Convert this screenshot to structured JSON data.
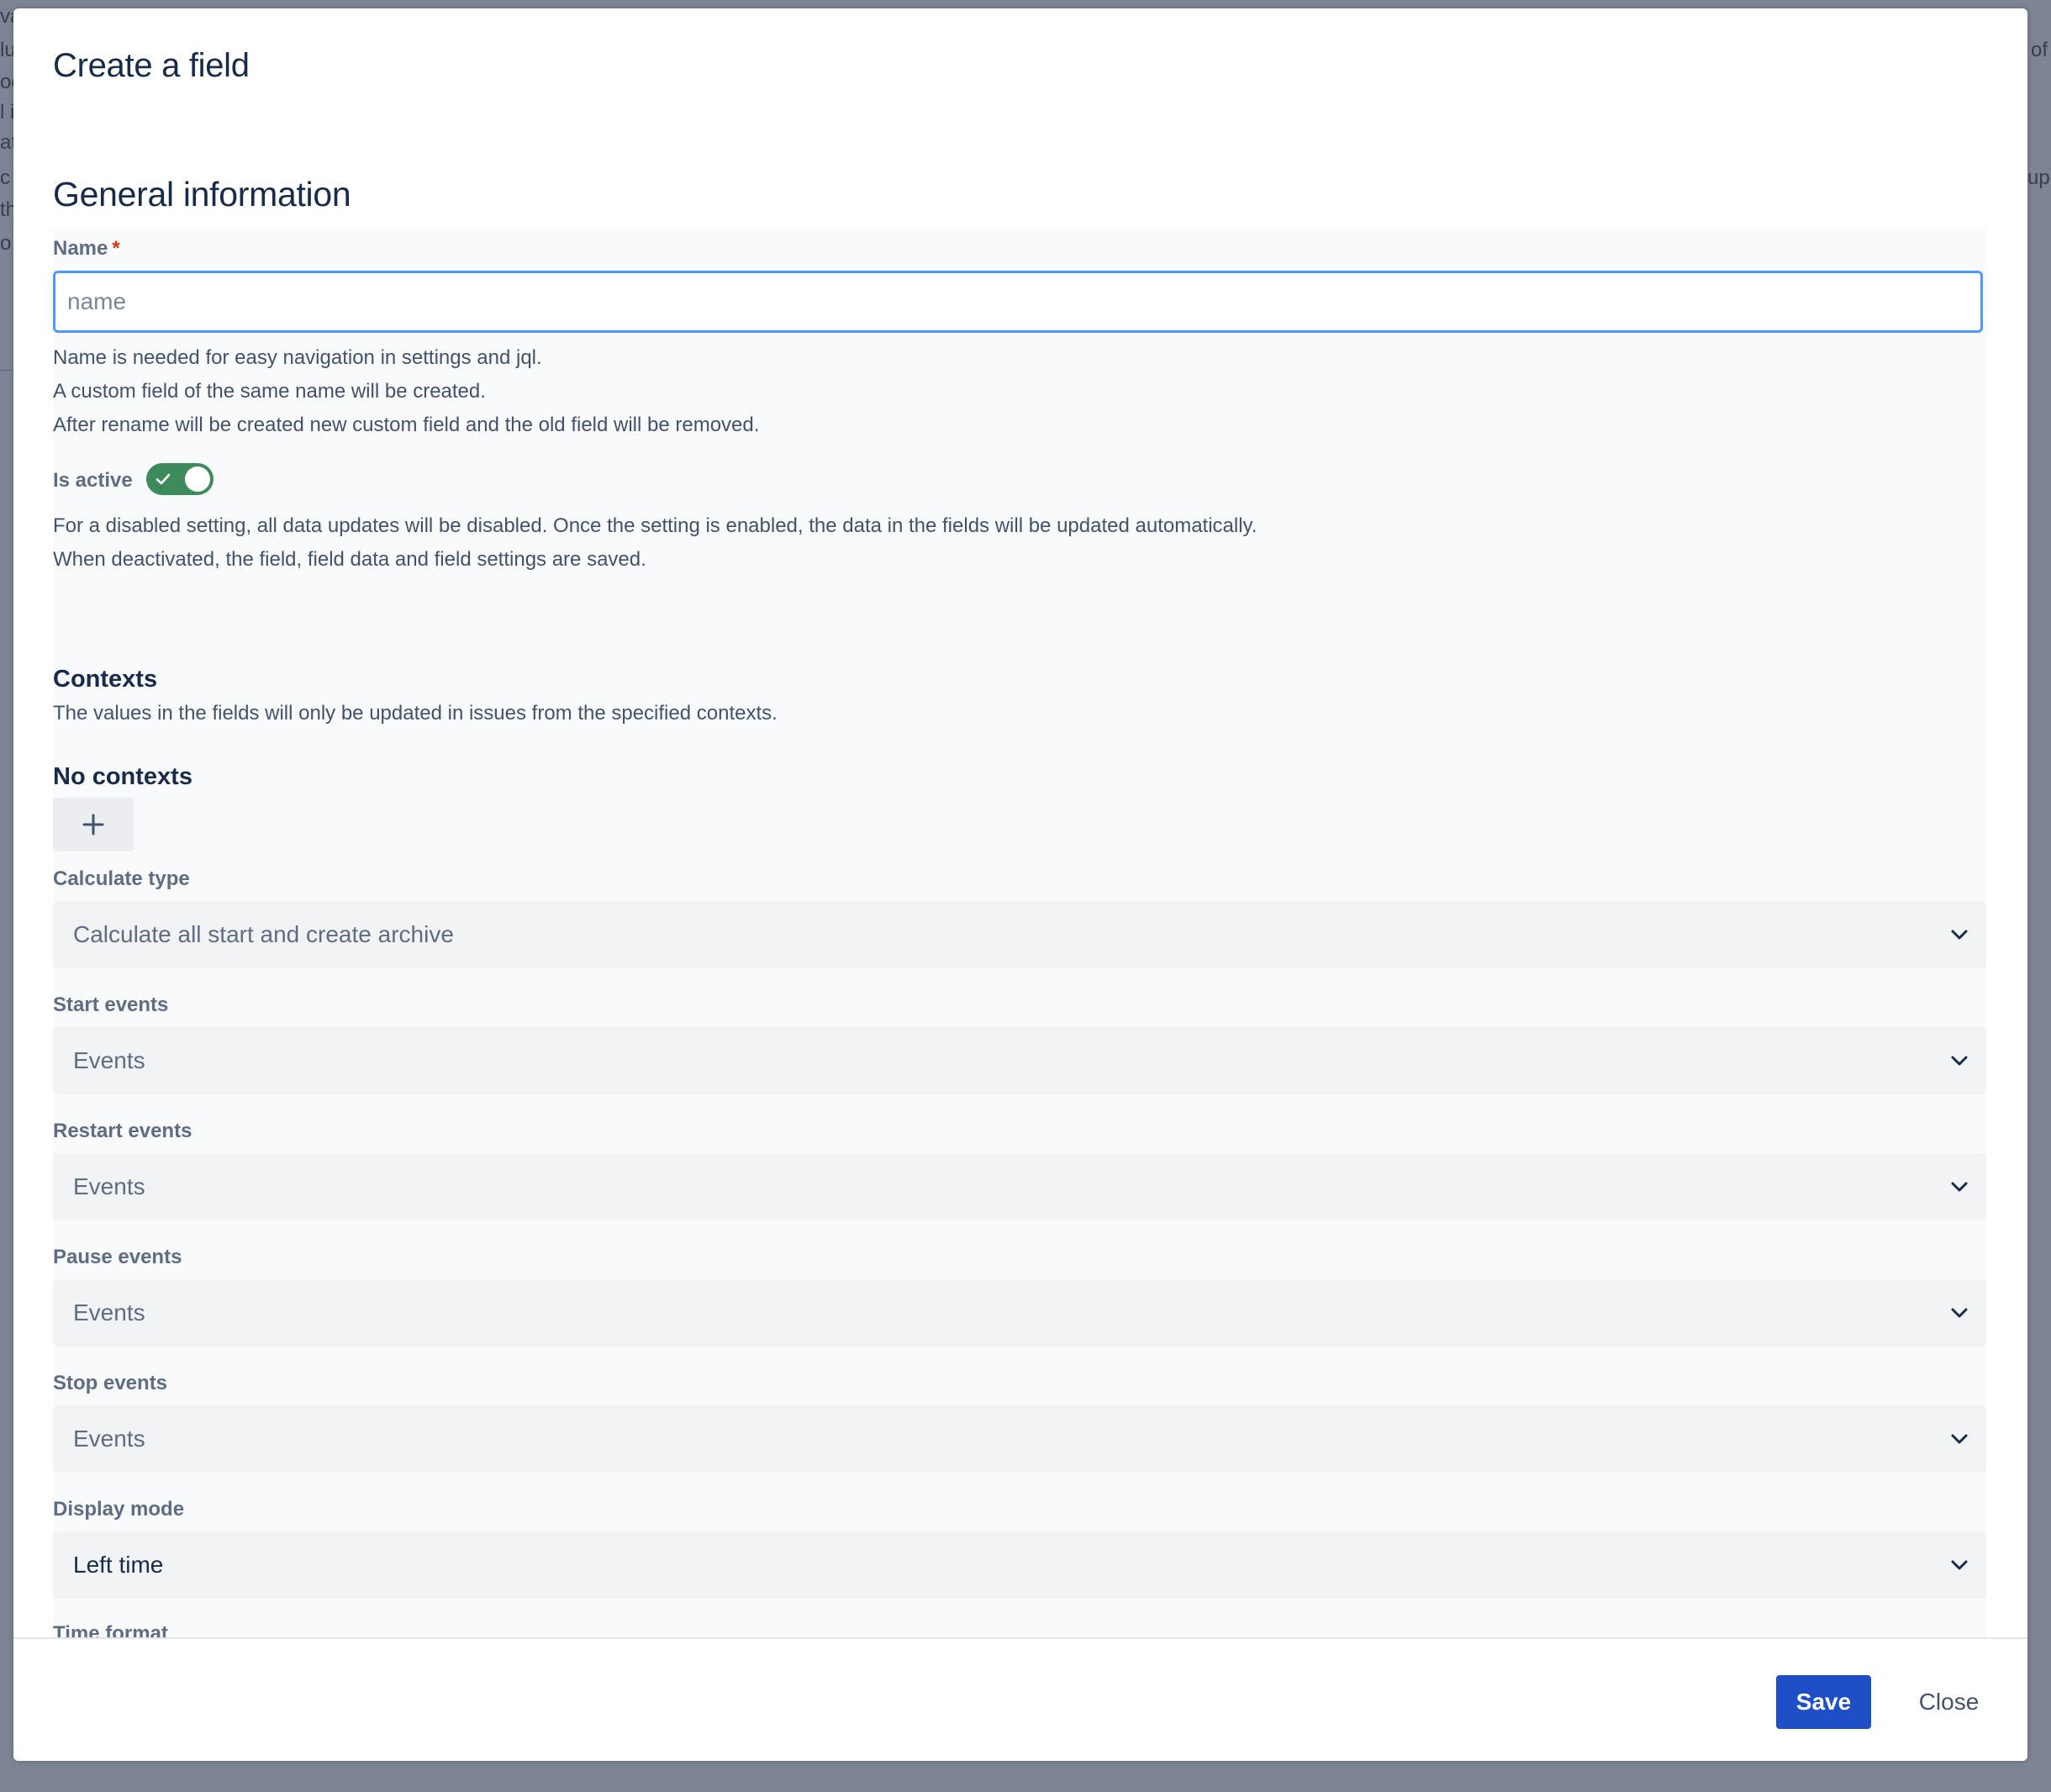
{
  "background": {
    "left_fragments": [
      "va",
      "lu",
      "oc",
      "l i",
      "at",
      "c",
      "th",
      "o"
    ],
    "right_fragments": [
      "of",
      "upo"
    ]
  },
  "modal": {
    "title": "Create a field"
  },
  "general": {
    "section_title": "General information",
    "name": {
      "label": "Name",
      "required_mark": "*",
      "placeholder": "name",
      "value": "",
      "help": [
        "Name is needed for easy navigation in settings and jql.",
        "A custom field of the same name will be created.",
        "After rename will be created new custom field and the old field will be removed."
      ]
    },
    "is_active": {
      "label": "Is active",
      "checked": true,
      "help": [
        "For a disabled setting, all data updates will be disabled. Once the setting is enabled, the data in the fields will be updated automatically.",
        "When deactivated, the field, field data and field settings are saved."
      ]
    }
  },
  "contexts": {
    "title": "Contexts",
    "description": "The values in the fields will only be updated in issues from the specified contexts.",
    "empty_title": "No contexts",
    "add_icon": "plus-icon"
  },
  "fields": {
    "calculate_type": {
      "label": "Calculate type",
      "value": "Calculate all start and create archive"
    },
    "start_events": {
      "label": "Start events",
      "value": "Events"
    },
    "restart_events": {
      "label": "Restart events",
      "value": "Events"
    },
    "pause_events": {
      "label": "Pause events",
      "value": "Events"
    },
    "stop_events": {
      "label": "Stop events",
      "value": "Events"
    },
    "display_mode": {
      "label": "Display mode",
      "value": "Left time"
    },
    "time_format": {
      "label": "Time format"
    }
  },
  "footer": {
    "save_label": "Save",
    "close_label": "Close"
  },
  "colors": {
    "primary": "#1f4fc7",
    "toggle_on": "#3d8a5d",
    "focus_border": "#4c9aff",
    "required": "#de350b",
    "heading": "#172b4d"
  }
}
